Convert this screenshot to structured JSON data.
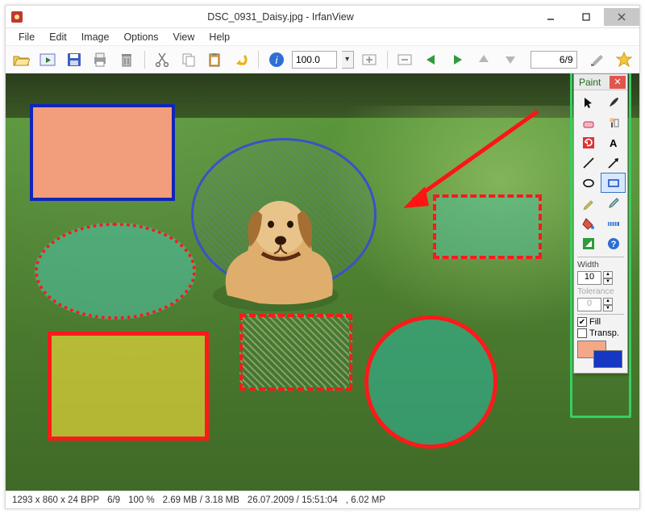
{
  "titlebar": {
    "title": "DSC_0931_Daisy.jpg - IrfanView"
  },
  "menubar": {
    "items": [
      "File",
      "Edit",
      "Image",
      "Options",
      "View",
      "Help"
    ]
  },
  "toolbar": {
    "zoom_value": "100.0",
    "counter": "6/9"
  },
  "statusbar": {
    "dimensions": "1293 x 860 x 24 BPP",
    "counter": "6/9",
    "zoom": "100 %",
    "sizes": "2.69 MB / 3.18 MB",
    "datetime": "26.07.2009 / 15:51:04",
    "megapixels": ", 6.02 MP"
  },
  "paint": {
    "title": "Paint",
    "width_label": "Width",
    "width_value": "10",
    "tolerance_label": "Tolerance",
    "tolerance_value": "0",
    "fill_label": "Fill",
    "transp_label": "Transp.",
    "fg_color": "#f4a887",
    "bg_color": "#1637c2"
  }
}
